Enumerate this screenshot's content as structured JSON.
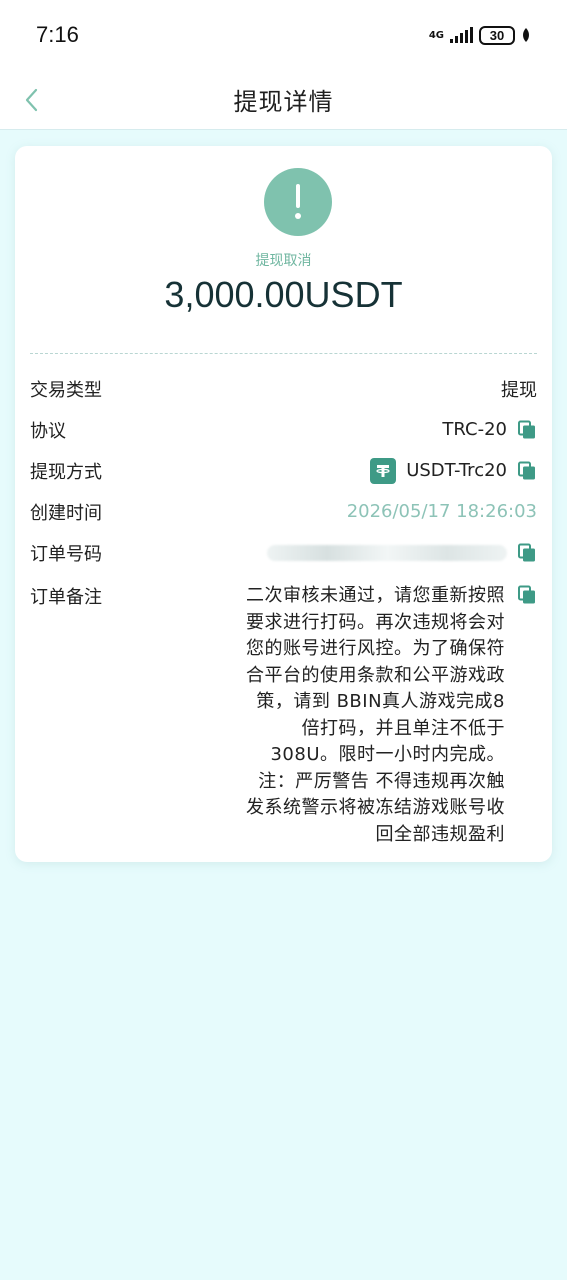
{
  "statusbar": {
    "time": "7:16",
    "network": "4G",
    "battery": "30"
  },
  "header": {
    "back_icon": "chevron-left-icon",
    "title": "提现详情"
  },
  "summary": {
    "status": "提现取消",
    "amount": "3,000.00USDT",
    "status_color": "#7fc2ae"
  },
  "details": {
    "type": {
      "label": "交易类型",
      "value": "提现"
    },
    "protocol": {
      "label": "协议",
      "value": "TRC-20"
    },
    "method": {
      "label": "提现方式",
      "value": "USDT-Trc20"
    },
    "created": {
      "label": "创建时间",
      "value": "2026/05/17 18:26:03"
    },
    "order": {
      "label": "订单号码"
    },
    "remark": {
      "label": "订单备注",
      "value": "二次审核未通过，请您重新按照要求进行打码。再次违规将会对您的账号进行风控。为了确保符合平台的使用条款和公平游戏政策，请到 BBIN真人游戏完成8倍打码，并且单注不低于308U。限时一小时内完成。注：严厉警告 不得违规再次触发系统警示将被冻结游戏账号收回全部违规盈利"
    }
  },
  "colors": {
    "accent": "#3e9a86",
    "muted": "#8dc3b7",
    "background": "#e6fbfc"
  }
}
